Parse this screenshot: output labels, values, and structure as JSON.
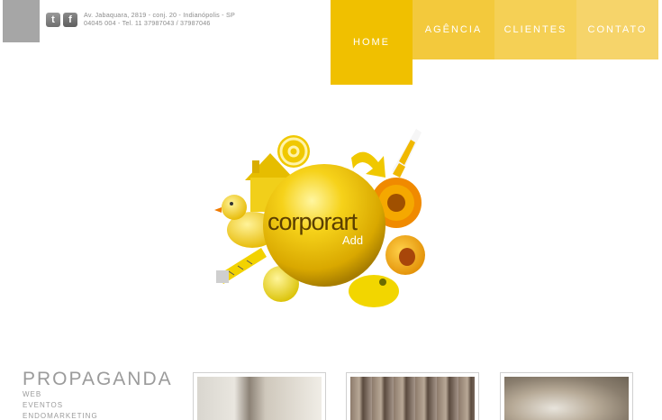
{
  "header": {
    "address_line1": "Av. Jabaquara, 2819 - conj. 20 - Indianópolis - SP",
    "address_line2": "04045 004 - Tel. 11 37987043 / 37987046",
    "twitter_glyph": "t",
    "facebook_glyph": "f"
  },
  "nav": {
    "items": [
      {
        "label": "HOME",
        "active": true
      },
      {
        "label": "AGÊNCIA"
      },
      {
        "label": "CLIENTES"
      },
      {
        "label": "CONTATO"
      }
    ]
  },
  "hero": {
    "brand_main": "corporart",
    "brand_sub": "Add"
  },
  "services": {
    "title": "PROPAGANDA",
    "links": [
      "WEB",
      "EVENTOS",
      "ENDOMARKETING"
    ]
  },
  "colors": {
    "accent": "#f0c000",
    "nav_agencia": "#f3c93c",
    "nav_clientes": "#f5d055",
    "nav_contato": "#f6d46a",
    "text_gray": "#9b9b9b"
  }
}
